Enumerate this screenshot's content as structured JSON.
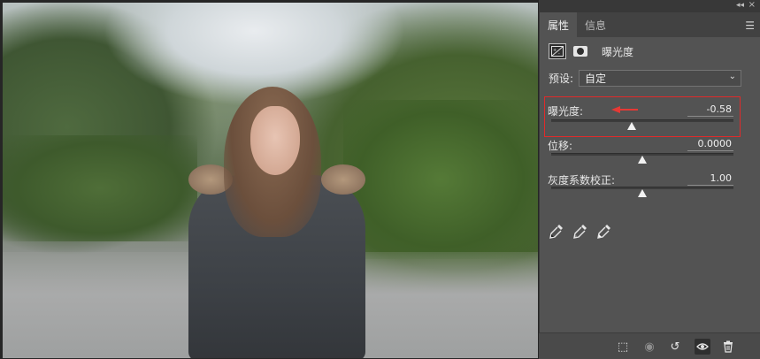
{
  "panel": {
    "tabs": [
      {
        "label": "属性"
      },
      {
        "label": "信息"
      }
    ],
    "adjustment_title": "曝光度",
    "preset": {
      "label": "预设:",
      "value": "自定"
    },
    "sliders": [
      {
        "label": "曝光度:",
        "value": "-0.58",
        "level": 0.44
      },
      {
        "label": "位移:",
        "value": "0.0000",
        "level": 0.5
      },
      {
        "label": "灰度系数校正:",
        "value": "1.00",
        "level": 0.5
      }
    ],
    "droppers": [
      {
        "icon": "black-point-eyedropper-icon"
      },
      {
        "icon": "gray-point-eyedropper-icon"
      },
      {
        "icon": "white-point-eyedropper-icon"
      }
    ],
    "bottom_icons": [
      "clip-to-layer-icon",
      "view-previous-state-icon",
      "reset-icon",
      "visibility-eye-icon",
      "delete-icon"
    ]
  },
  "colors": {
    "panel_bg": "#535353",
    "highlight": "#e02a2a",
    "arrow": "#e53935"
  }
}
